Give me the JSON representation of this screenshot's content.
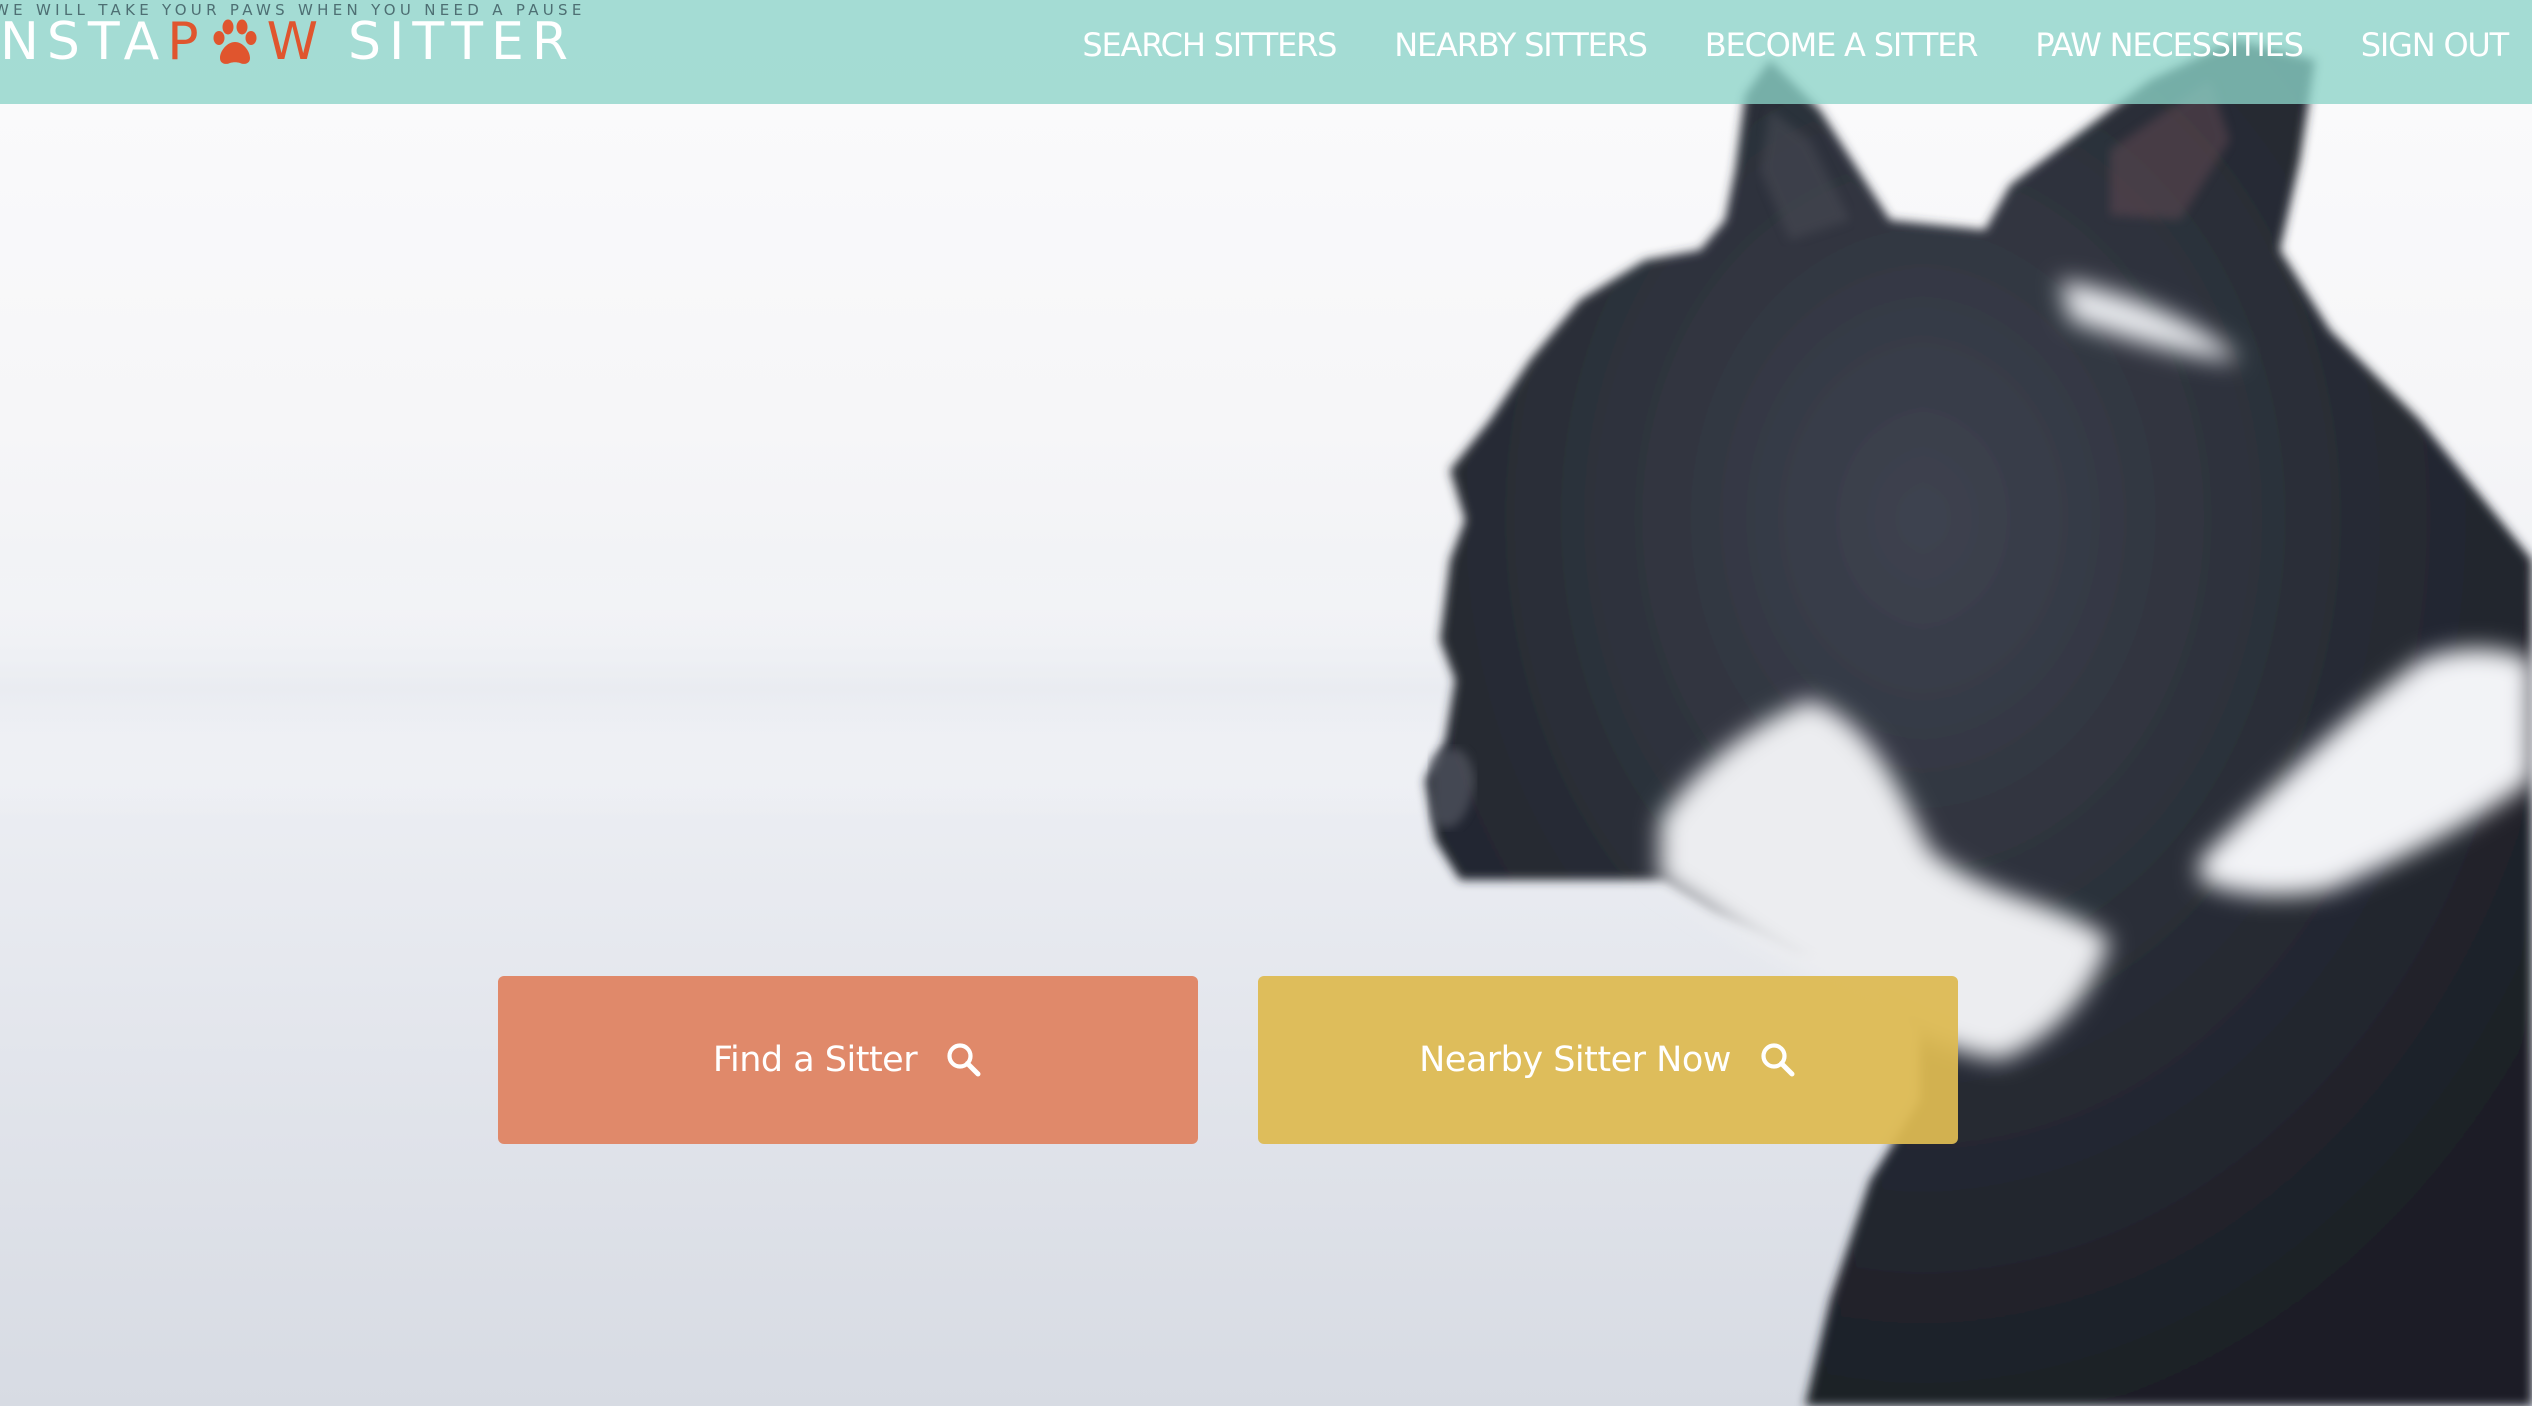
{
  "brand": {
    "tagline": "WE WILL TAKE YOUR PAWS WHEN YOU NEED A PAUSE",
    "logo_part1": "NSTA",
    "logo_part2": "P",
    "logo_part3": "W",
    "logo_part4": "SITTER",
    "logo_icon": "paw-icon",
    "accent_color": "#e0552e"
  },
  "nav": {
    "items": [
      {
        "label": "SEARCH SITTERS"
      },
      {
        "label": "NEARBY SITTERS"
      },
      {
        "label": "BECOME A SITTER"
      },
      {
        "label": "PAW NECESSITIES"
      },
      {
        "label": "SIGN OUT"
      }
    ],
    "background_color": "#8cd4c8"
  },
  "hero": {
    "image": "dog-photo",
    "find_button": {
      "label": "Find a Sitter",
      "icon": "search-icon",
      "color": "#e0896a"
    },
    "nearby_button": {
      "label": "Nearby Sitter Now",
      "icon": "search-icon",
      "color": "#ddba52"
    }
  }
}
